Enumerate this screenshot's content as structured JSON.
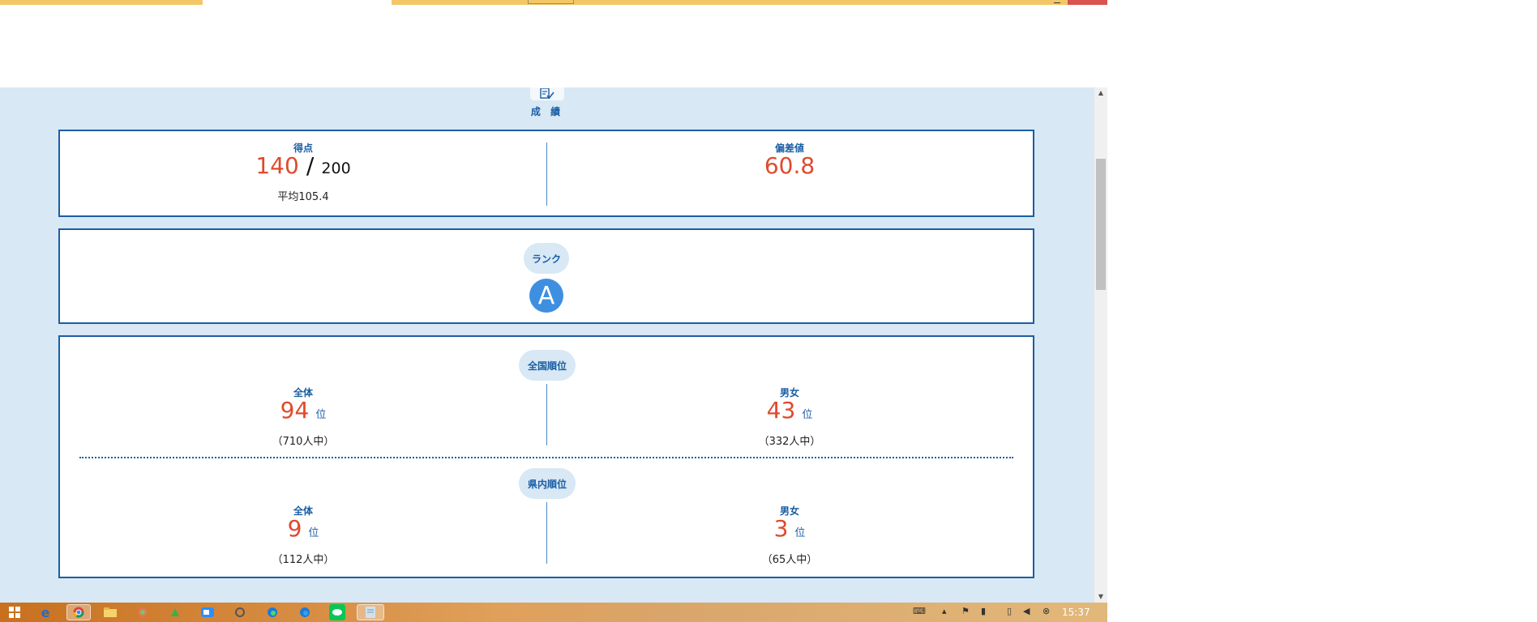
{
  "section": {
    "title": "成 績",
    "icon": "checklist-icon"
  },
  "score": {
    "label": "得点",
    "value": "140",
    "separator": "/",
    "max": "200",
    "average": "平均105.4"
  },
  "deviation": {
    "label": "偏差値",
    "value": "60.8"
  },
  "rank": {
    "label": "ランク",
    "grade": "A"
  },
  "national": {
    "label": "全国順位",
    "overall": {
      "label": "全体",
      "value": "94",
      "unit": "位",
      "of": "（710人中）"
    },
    "gender": {
      "label": "男女",
      "value": "43",
      "unit": "位",
      "of": "（332人中）"
    }
  },
  "prefecture": {
    "label": "県内順位",
    "overall": {
      "label": "全体",
      "value": "9",
      "unit": "位",
      "of": "（112人中）"
    },
    "gender": {
      "label": "男女",
      "value": "3",
      "unit": "位",
      "of": "（65人中）"
    }
  },
  "taskbar": {
    "clock": "15:37",
    "apps": [
      "start-icon",
      "ie-icon",
      "chrome-icon",
      "folder-icon",
      "photos-icon",
      "app-icon",
      "zoom-icon",
      "tool-icon",
      "edge-icon",
      "edge-icon",
      "line-icon",
      "notepad-icon"
    ]
  },
  "colors": {
    "accent": "#1a5ea3",
    "highlight": "#e04a2d",
    "background": "#d8e8f4"
  }
}
